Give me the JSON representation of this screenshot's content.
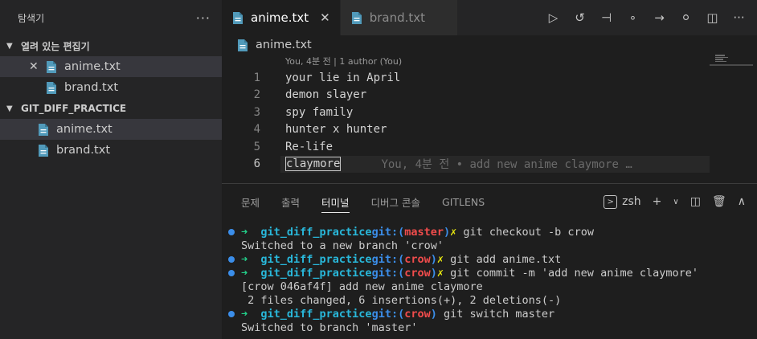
{
  "sidebar": {
    "title": "탐색기",
    "more": "···",
    "open_editors": {
      "label": "열려 있는 편집기",
      "files": [
        {
          "name": "anime.txt"
        },
        {
          "name": "brand.txt"
        }
      ]
    },
    "folder": {
      "label": "GIT_DIFF_PRACTICE",
      "files": [
        {
          "name": "anime.txt"
        },
        {
          "name": "brand.txt"
        }
      ]
    }
  },
  "editor": {
    "tabs": [
      {
        "label": "anime.txt",
        "close": "✕"
      },
      {
        "label": "brand.txt"
      }
    ],
    "breadcrumb": "anime.txt",
    "codelens": "You, 4분 전 | 1 author (You)",
    "lines": [
      {
        "n": "1",
        "text": "your lie in April"
      },
      {
        "n": "2",
        "text": "demon slayer"
      },
      {
        "n": "3",
        "text": "spy family"
      },
      {
        "n": "4",
        "text": "hunter x hunter"
      },
      {
        "n": "5",
        "text": "Re-life"
      },
      {
        "n": "6",
        "text": "claymore"
      }
    ],
    "blame": "You, 4분 전 • add new anime claymore …"
  },
  "panel": {
    "tabs": [
      "문제",
      "출력",
      "터미널",
      "디버그 콘솔",
      "GITLENS"
    ],
    "active_tab": "터미널",
    "shell": "zsh",
    "terminal": [
      {
        "dir": "git_diff_practice",
        "git": "git:(",
        "branch": "master",
        "close": ")",
        "cmd": " git checkout -b crow"
      },
      {
        "out": "Switched to a new branch 'crow'"
      },
      {
        "dir": "git_diff_practice",
        "git": "git:(",
        "branch": "crow",
        "close": ")",
        "cmd": " git add anime.txt"
      },
      {
        "dir": "git_diff_practice",
        "git": "git:(",
        "branch": "crow",
        "close": ")",
        "cmd": " git commit -m 'add new anime claymore'"
      },
      {
        "out": "[crow 046af4f] add new anime claymore"
      },
      {
        "out": " 2 files changed, 6 insertions(+), 2 deletions(-)"
      },
      {
        "dir": "git_diff_practice",
        "git": "git:(",
        "branch": "crow",
        "close": ")",
        "cmd": " git switch master"
      },
      {
        "out": "Switched to branch 'master'"
      }
    ]
  },
  "colors": {
    "file_icon": "#519aba",
    "prompt_arrow": "#23d18b",
    "prompt_dir": "#29b8db",
    "branch": "#f14c4c"
  }
}
